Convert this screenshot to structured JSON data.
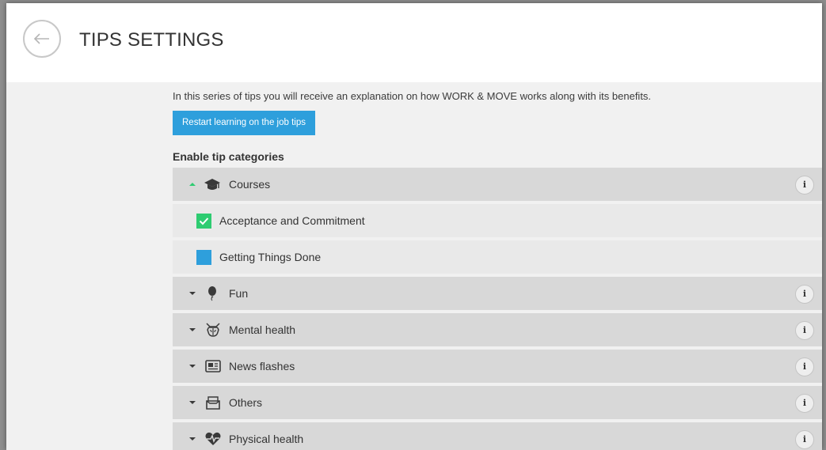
{
  "header": {
    "title": "TIPS SETTINGS",
    "back_icon": "arrow-left-icon"
  },
  "intro_text": "In this series of tips you will receive an explanation on how WORK & MOVE works along with its benefits.",
  "restart_button_label": "Restart learning on the job tips",
  "section_title": "Enable tip categories",
  "colors": {
    "accent": "#2e9fdc",
    "checked": "#2ecc71",
    "row_bg": "#d8d8d8",
    "sub_row_bg": "#e9e9e9",
    "caret_open": "#2ecc71"
  },
  "categories": [
    {
      "label": "Courses",
      "icon": "graduation-cap-icon",
      "expanded": true,
      "items": [
        {
          "label": "Acceptance and Commitment",
          "checked": true
        },
        {
          "label": "Getting Things Done",
          "checked": false
        }
      ]
    },
    {
      "label": "Fun",
      "icon": "balloon-icon",
      "expanded": false
    },
    {
      "label": "Mental health",
      "icon": "brain-icon",
      "expanded": false
    },
    {
      "label": "News flashes",
      "icon": "newspaper-icon",
      "expanded": false
    },
    {
      "label": "Others",
      "icon": "inbox-icon",
      "expanded": false
    },
    {
      "label": "Physical health",
      "icon": "heartbeat-icon",
      "expanded": false
    }
  ],
  "info_label": "i"
}
